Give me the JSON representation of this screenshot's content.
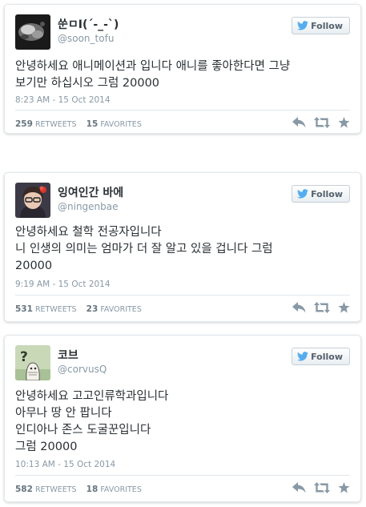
{
  "tweets": [
    {
      "name": "쑨ㅁI(´-_-`)",
      "handle": "@soon_tofu",
      "follow_label": "Follow",
      "text_lines": [
        "안녕하세요 애니메이션과 입니다 애니를 좋아한다면 그냥",
        "보기만 하십시오 그럼 20000"
      ],
      "timestamp": "8:23 AM - 15 Oct 2014",
      "retweets": "259",
      "retweets_label": "RETWEETS",
      "favorites": "15",
      "favorites_label": "FAVORITES"
    },
    {
      "name": "잉여인간 바에",
      "handle": "@ningenbae",
      "follow_label": "Follow",
      "text_lines": [
        "안녕하세요 철학 전공자입니다",
        "니 인생의 의미는 엄마가 더 잘 알고 있을 겁니다 그럼",
        "20000"
      ],
      "timestamp": "9:19 AM - 15 Oct 2014",
      "retweets": "531",
      "retweets_label": "RETWEETS",
      "favorites": "23",
      "favorites_label": "FAVORITES"
    },
    {
      "name": "코브",
      "handle": "@corvusQ",
      "follow_label": "Follow",
      "text_lines": [
        "안녕하세요 고고인류학과입니다",
        "아무나 땅 안 팝니다",
        "인디아나 존스 도굴꾼입니다",
        "그럼 20000"
      ],
      "timestamp": "10:13 AM - 15 Oct 2014",
      "retweets": "582",
      "retweets_label": "RETWEETS",
      "favorites": "18",
      "favorites_label": "FAVORITES"
    }
  ],
  "icons": {
    "follow": "twitter-bird-icon",
    "reply": "reply-icon",
    "retweet": "retweet-icon",
    "favorite": "star-icon"
  },
  "colors": {
    "card_border": "#e1e8ed",
    "muted_text": "#8899a6",
    "body_text": "#292f33",
    "bird_blue": "#55acee",
    "action_gray": "#8899a6"
  }
}
